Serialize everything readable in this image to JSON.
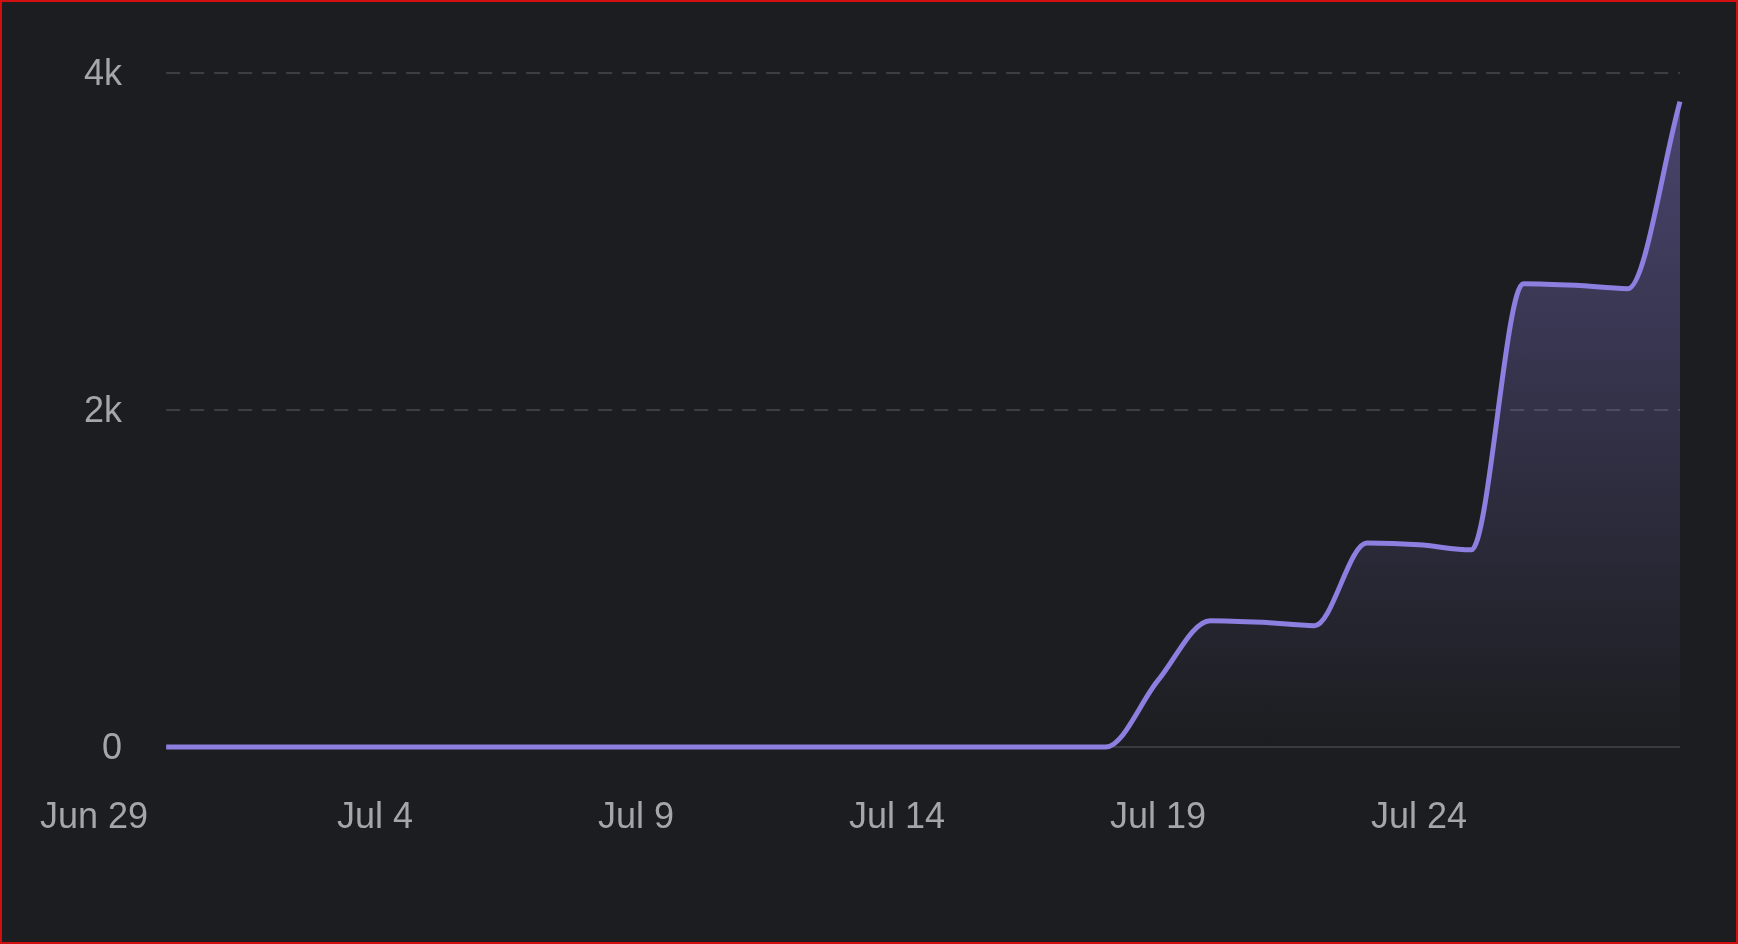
{
  "chart": {
    "chart_data": {
      "type": "area",
      "categories": [
        "Jun 29",
        null,
        null,
        null,
        null,
        "Jul 4",
        null,
        null,
        null,
        null,
        "Jul 9",
        null,
        null,
        null,
        null,
        "Jul 14",
        null,
        null,
        null,
        null,
        "Jul 19",
        null,
        null,
        null,
        null,
        "Jul 24",
        null,
        null,
        null,
        null,
        null
      ],
      "series": [
        {
          "color": "#8b7fe0",
          "values": [
            null,
            0,
            0,
            0,
            0,
            0,
            0,
            0,
            0,
            0,
            0,
            0,
            0,
            0,
            0,
            0,
            0,
            0,
            0,
            0,
            395,
            750,
            740,
            720,
            1210,
            1200,
            1170,
            2750,
            2740,
            2720,
            3830
          ]
        }
      ],
      "ylim": [
        0,
        4000
      ],
      "yticks": [
        {
          "value": 0,
          "label": "0"
        },
        {
          "value": 2000,
          "label": "2k"
        },
        {
          "value": 4000,
          "label": "4k"
        }
      ]
    }
  }
}
